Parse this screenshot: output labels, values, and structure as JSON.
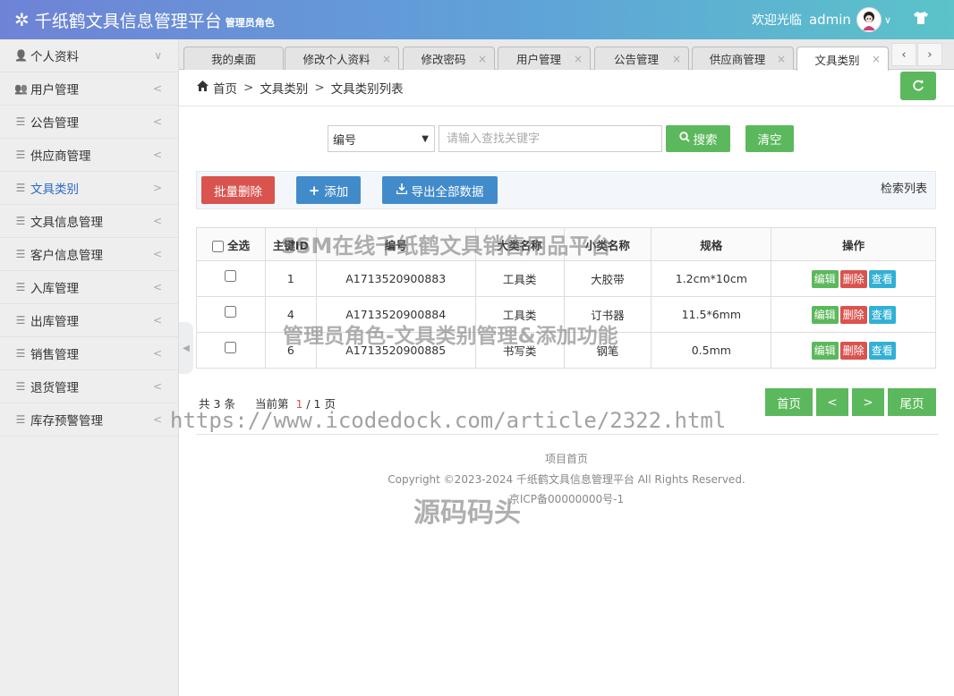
{
  "header": {
    "title": "千纸鹤文具信息管理平台",
    "role": "管理员角色",
    "welcome": "欢迎光临",
    "username": "admin"
  },
  "sidebar": {
    "items": [
      {
        "label": "个人资料",
        "arrow": "∨",
        "icon": "user-icon"
      },
      {
        "label": "用户管理",
        "arrow": "<",
        "icon": "users-icon"
      },
      {
        "label": "公告管理",
        "arrow": "<",
        "icon": "list-icon"
      },
      {
        "label": "供应商管理",
        "arrow": "<",
        "icon": "list-icon"
      },
      {
        "label": "文具类别",
        "arrow": ">",
        "icon": "list-icon"
      },
      {
        "label": "文具信息管理",
        "arrow": "<",
        "icon": "list-icon"
      },
      {
        "label": "客户信息管理",
        "arrow": "<",
        "icon": "list-icon"
      },
      {
        "label": "入库管理",
        "arrow": "<",
        "icon": "list-icon"
      },
      {
        "label": "出库管理",
        "arrow": "<",
        "icon": "list-icon"
      },
      {
        "label": "销售管理",
        "arrow": "<",
        "icon": "list-icon"
      },
      {
        "label": "退货管理",
        "arrow": "<",
        "icon": "list-icon"
      },
      {
        "label": "库存预警管理",
        "arrow": "<",
        "icon": "list-icon"
      }
    ],
    "active_index": 4
  },
  "tabs": [
    {
      "label": "我的桌面"
    },
    {
      "label": "修改个人资料"
    },
    {
      "label": "修改密码"
    },
    {
      "label": "用户管理"
    },
    {
      "label": "公告管理"
    },
    {
      "label": "供应商管理"
    },
    {
      "label": "文具类别"
    }
  ],
  "breadcrumb": {
    "home": "首页",
    "level1": "文具类别",
    "level2": "文具类别列表"
  },
  "search": {
    "field_selected": "编号",
    "placeholder": "请输入查找关键字",
    "search_label": "搜索",
    "clear_label": "清空"
  },
  "toolbar": {
    "batch_delete": "批量删除",
    "add": "添加",
    "export": "导出全部数据",
    "list_title": "检索列表"
  },
  "table": {
    "select_all": "全选",
    "columns": [
      "主键ID",
      "编号",
      "大类名称",
      "小类名称",
      "规格",
      "操作"
    ],
    "rows": [
      {
        "id": "1",
        "code": "A1713520900883",
        "major": "工具类",
        "minor": "大胶带",
        "spec": "1.2cm*10cm"
      },
      {
        "id": "4",
        "code": "A1713520900884",
        "major": "工具类",
        "minor": "订书器",
        "spec": "11.5*6mm"
      },
      {
        "id": "6",
        "code": "A1713520900885",
        "major": "书写类",
        "minor": "钢笔",
        "spec": "0.5mm"
      }
    ],
    "actions": {
      "edit": "编辑",
      "delete": "删除",
      "view": "查看"
    }
  },
  "pagination": {
    "total_prefix": "共",
    "total": "3",
    "total_suffix": "条",
    "current_prefix": "当前第",
    "current": "1",
    "pages": "/ 1 页",
    "first": "首页",
    "prev": "<",
    "next": ">",
    "last": "尾页"
  },
  "footer": {
    "link": "项目首页",
    "copyright": "Copyright ©2023-2024 千纸鹤文具信息管理平台 All Rights Reserved.",
    "icp": "京ICP备00000000号-1"
  },
  "watermarks": {
    "line1": "SSM在线千纸鹤文具销售用品平台",
    "line2": "管理员角色-文具类别管理&添加功能",
    "url": "https://www.icodedock.com/article/2322.html",
    "brand": "源码码头"
  },
  "colors": {
    "primary_green": "#5cb85c",
    "danger_red": "#d9534f",
    "primary_blue": "#428bca",
    "info_blue": "#31b0d5"
  }
}
